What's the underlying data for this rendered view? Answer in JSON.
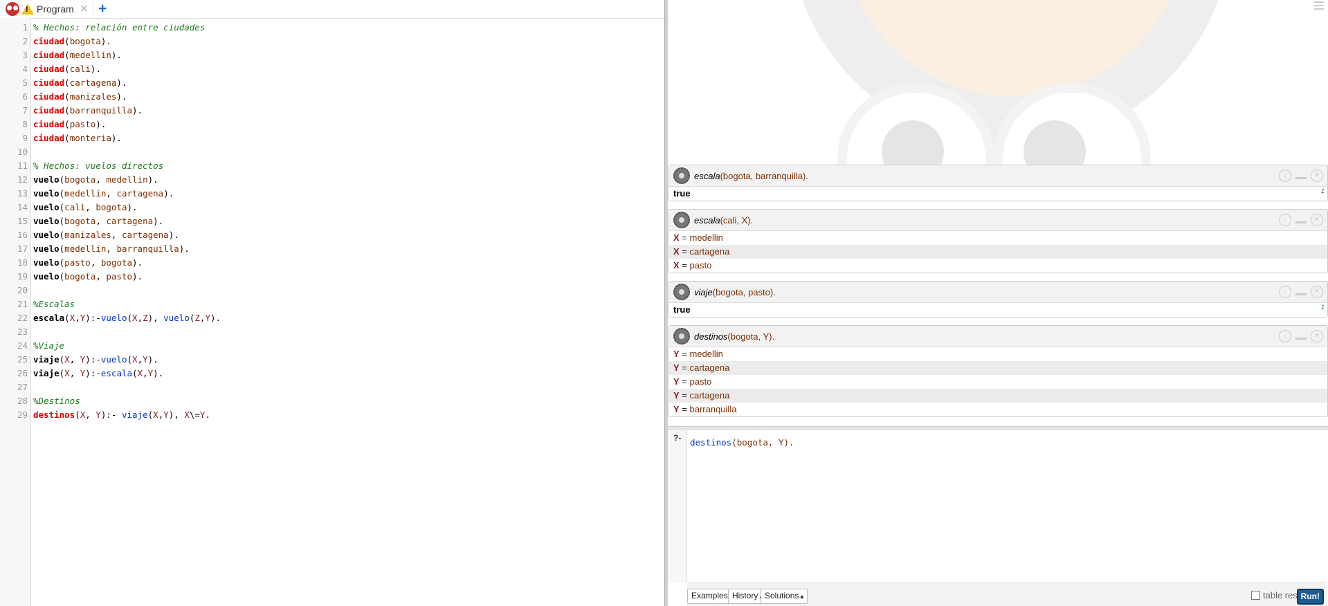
{
  "tab": {
    "label": "Program",
    "close_icon": "close-icon",
    "add_icon": "plus-icon"
  },
  "editor": {
    "lines": [
      {
        "n": "1",
        "t": "% Hechos: relación entre ciudades"
      },
      {
        "n": "2",
        "t": "ciudad(bogota)."
      },
      {
        "n": "3",
        "t": "ciudad(medellin)."
      },
      {
        "n": "4",
        "t": "ciudad(cali)."
      },
      {
        "n": "5",
        "t": "ciudad(cartagena)."
      },
      {
        "n": "6",
        "t": "ciudad(manizales)."
      },
      {
        "n": "7",
        "t": "ciudad(barranquilla)."
      },
      {
        "n": "8",
        "t": "ciudad(pasto)."
      },
      {
        "n": "9",
        "t": "ciudad(monteria)."
      },
      {
        "n": "10",
        "t": ""
      },
      {
        "n": "11",
        "t": "% Hechos: vuelos directos"
      },
      {
        "n": "12",
        "t": "vuelo(bogota, medellin)."
      },
      {
        "n": "13",
        "t": "vuelo(medellin, cartagena)."
      },
      {
        "n": "14",
        "t": "vuelo(cali, bogota)."
      },
      {
        "n": "15",
        "t": "vuelo(bogota, cartagena)."
      },
      {
        "n": "16",
        "t": "vuelo(manizales, cartagena)."
      },
      {
        "n": "17",
        "t": "vuelo(medellin, barranquilla)."
      },
      {
        "n": "18",
        "t": "vuelo(pasto, bogota)."
      },
      {
        "n": "19",
        "t": "vuelo(bogota, pasto)."
      },
      {
        "n": "20",
        "t": ""
      },
      {
        "n": "21",
        "t": "%Escalas"
      },
      {
        "n": "22",
        "t": "escala(X,Y):-vuelo(X,Z), vuelo(Z,Y)."
      },
      {
        "n": "23",
        "t": ""
      },
      {
        "n": "24",
        "t": "%Viaje"
      },
      {
        "n": "25",
        "t": "viaje(X, Y):-vuelo(X,Y)."
      },
      {
        "n": "26",
        "t": "viaje(X, Y):-escala(X,Y)."
      },
      {
        "n": "27",
        "t": ""
      },
      {
        "n": "28",
        "t": "%Destinos"
      },
      {
        "n": "29",
        "t": "destinos(X, Y):- viaje(X,Y), X\\=Y."
      }
    ]
  },
  "queries": [
    {
      "pred": "escala",
      "args": "(bogota, barranquilla).",
      "answers": [
        {
          "type": "bool",
          "text": "true",
          "count": "1"
        }
      ]
    },
    {
      "pred": "escala",
      "args": "(cali, X).",
      "answers": [
        {
          "type": "bind",
          "var": "X",
          "eq": " = ",
          "val": "medellin"
        },
        {
          "type": "bind",
          "var": "X",
          "eq": " = ",
          "val": "cartagena"
        },
        {
          "type": "bind",
          "var": "X",
          "eq": " = ",
          "val": "pasto"
        }
      ]
    },
    {
      "pred": "viaje",
      "args": "(bogota, pasto).",
      "answers": [
        {
          "type": "bool",
          "text": "true",
          "count": "1"
        }
      ]
    },
    {
      "pred": "destinos",
      "args": "(bogota, Y).",
      "answers": [
        {
          "type": "bind",
          "var": "Y",
          "eq": " = ",
          "val": "medellin"
        },
        {
          "type": "bind",
          "var": "Y",
          "eq": " = ",
          "val": "cartagena"
        },
        {
          "type": "bind",
          "var": "Y",
          "eq": " = ",
          "val": "pasto"
        },
        {
          "type": "bind",
          "var": "Y",
          "eq": " = ",
          "val": "cartagena"
        },
        {
          "type": "bind",
          "var": "Y",
          "eq": " = ",
          "val": "barranquilla"
        }
      ]
    }
  ],
  "query_editor": {
    "prompt": "?-",
    "pred": "destinos",
    "args": "(bogota, Y)."
  },
  "toolbar": {
    "examples": "Examples",
    "history": "History",
    "solutions": "Solutions",
    "table_results": "table results",
    "run": "Run!"
  },
  "icons": {
    "owl": "swish-owl-icon",
    "warning": "warning-icon",
    "gear": "gear-icon",
    "menu": "hamburger-menu-icon"
  }
}
